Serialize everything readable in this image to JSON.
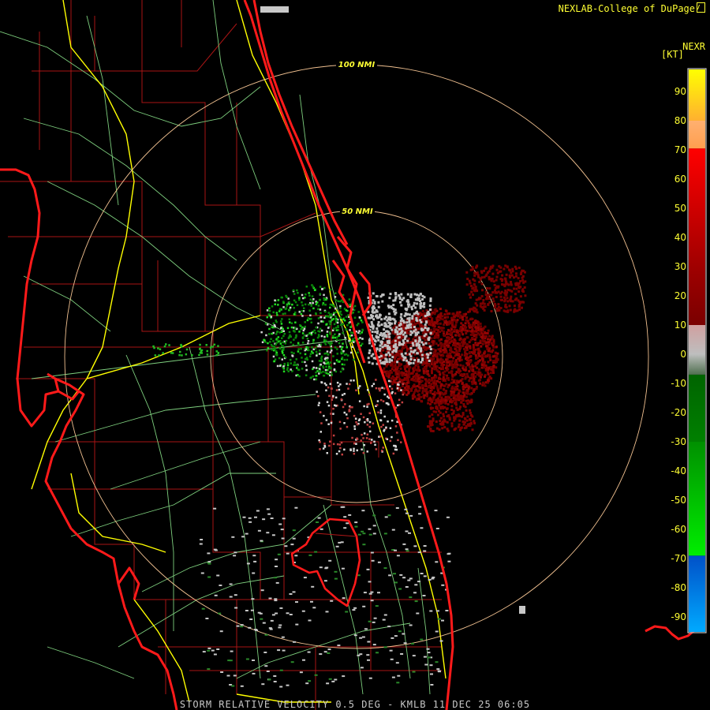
{
  "header": {
    "credit": "NEXLAB-College of DuPage",
    "product": "NEXR",
    "units": "[KT]"
  },
  "caption": "STORM RELATIVE VELOCITY 0.5 DEG - KMLB 11 DEC 25 06:05",
  "range_rings": [
    {
      "label": "100 NMI"
    },
    {
      "label": "50 NMI"
    }
  ],
  "colorbar": {
    "ticks": [
      "90",
      "80",
      "70",
      "60",
      "50",
      "40",
      "30",
      "20",
      "10",
      "0",
      "-10",
      "-20",
      "-30",
      "-40",
      "-50",
      "-60",
      "-70",
      "-80",
      "-90"
    ],
    "colors": {
      "strong_outbound": "#ffff00",
      "outbound_orange": "#ff9f4f",
      "outbound_red": "#ff0000",
      "outbound_dark": "#7a0000",
      "near_zero": "#bebebe",
      "inbound_dark": "#006400",
      "inbound_green": "#00ee00",
      "inbound_blue": "#0050c8",
      "strong_inbound": "#00aaff"
    }
  },
  "map_colors": {
    "coastline": "#ff1a1a",
    "counties": "#b01818",
    "highways": "#ffff00",
    "roads": "#80d080",
    "rings": "#ffcc99"
  }
}
